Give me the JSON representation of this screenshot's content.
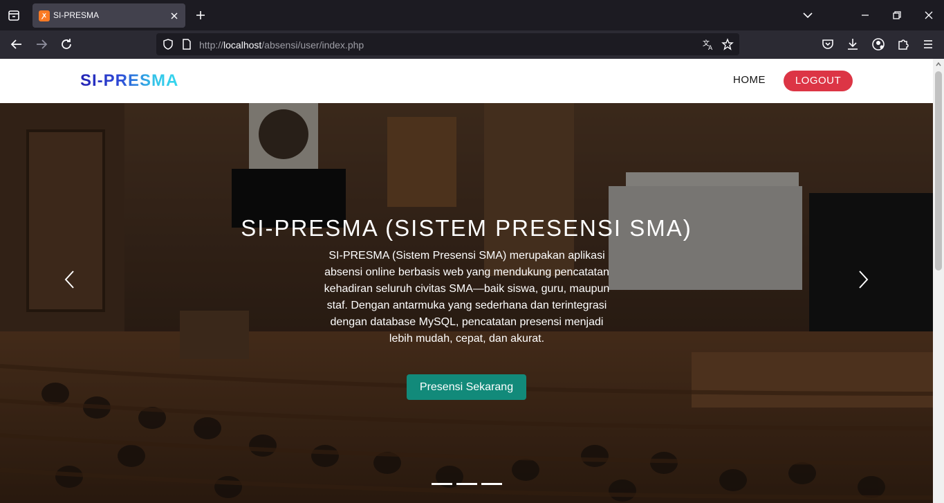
{
  "browser": {
    "tab_title": "SI-PRESMA",
    "tab_favicon": "xampp-icon",
    "url_prefix": "http://",
    "url_host": "localhost",
    "url_path": "/absensi/user/index.php"
  },
  "site": {
    "brand": "SI-PRESMA",
    "nav": {
      "home_label": "HOME",
      "logout_label": "LOGOUT"
    },
    "hero": {
      "title": "SI-PRESMA (SISTEM PRESENSI SMA)",
      "description": "SI-PRESMA (Sistem Presensi SMA) merupakan aplikasi absensi online berbasis web yang mendukung pencatatan kehadiran seluruh civitas SMA—baik siswa, guru, maupun staf. Dengan antarmuka yang sederhana dan terintegrasi dengan database MySQL, pencatatan presensi menjadi lebih mudah, cepat, dan akurat.",
      "cta_label": "Presensi Sekarang",
      "slide_count": 3,
      "background": "lecture-hall-photo"
    }
  },
  "colors": {
    "brand_gradient": [
      "#2524b4",
      "#35d7ee"
    ],
    "logout_bg": "#dc3545",
    "cta_bg": "#128a7a"
  }
}
